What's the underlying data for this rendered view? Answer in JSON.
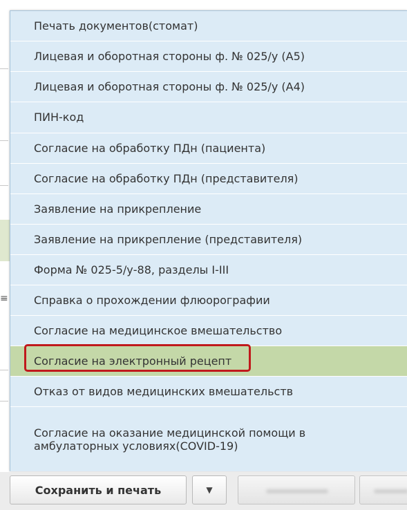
{
  "menu": {
    "items": [
      {
        "label": "Печать документов(стомат)"
      },
      {
        "label": "Лицевая и оборотная стороны ф. № 025/у (А5)"
      },
      {
        "label": "Лицевая и оборотная стороны ф. № 025/у (А4)"
      },
      {
        "label": "ПИН-код"
      },
      {
        "label": "Согласие на обработку ПДн (пациента)"
      },
      {
        "label": "Согласие на обработку ПДн (представителя)"
      },
      {
        "label": "Заявление на прикрепление"
      },
      {
        "label": "Заявление на прикрепление (представителя)"
      },
      {
        "label": "Форма № 025-5/у-88, разделы I-III"
      },
      {
        "label": "Справка о прохождении флюорографии"
      },
      {
        "label": "Согласие на медицинское вмешательство"
      },
      {
        "label": "Согласие на электронный рецепт",
        "active": true
      },
      {
        "label": "Отказ от видов медицинских вмешательств"
      },
      {
        "label_line1": "Согласие на оказание медицинской помощи в",
        "label_line2": "амбулаторных условиях(COVID-19)"
      }
    ]
  },
  "toolbar": {
    "save_print_label": "Сохранить и печать",
    "dropdown_icon": "caret-down-icon"
  },
  "colors": {
    "menu_bg": "#dcebf6",
    "active_bg": "#c4d8a8",
    "highlight_border": "#c0191c"
  }
}
